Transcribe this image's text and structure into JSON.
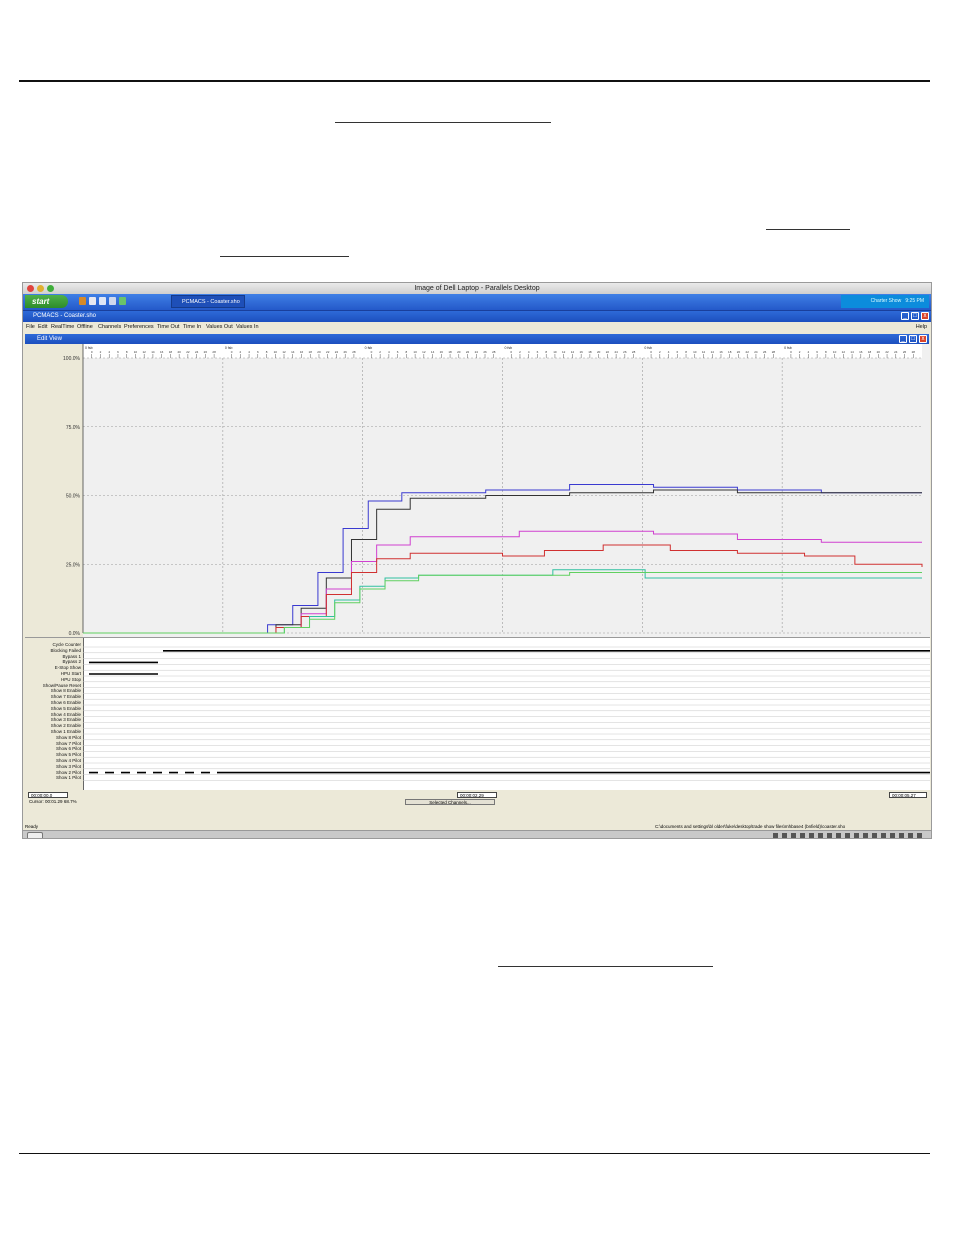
{
  "mac_window": {
    "title": "Image of Dell Laptop - Parallels Desktop"
  },
  "taskbar": {
    "start_label": "start",
    "task_button": "PCMACS - Coaster.sho",
    "tray_text": "Charter Show",
    "clock": "9:25 PM"
  },
  "app": {
    "title": "PCMACS - Coaster.sho",
    "menu": [
      "File",
      "Edit",
      "RealTime",
      "Offline",
      "Channels",
      "Preferences",
      "Time Out",
      "Time In",
      "Values Out",
      "Values In"
    ],
    "help": "Help",
    "edit_view_title": "Edit View"
  },
  "chart_data": {
    "type": "line",
    "y_ticks": [
      "100.0%",
      "75.0%",
      "50.0%",
      "25.0%",
      "0.0%"
    ],
    "ylim": [
      0,
      100
    ],
    "x_frame_labels": [
      "0 fsb",
      "0 fsb",
      "0 fsb",
      "0 fsb",
      "0 fsb",
      "0 fsb"
    ],
    "x_frame_ticks": [
      "0",
      "2",
      "4",
      "6",
      "8",
      "10",
      "12",
      "14",
      "16",
      "18",
      "20",
      "22",
      "24",
      "26",
      "28"
    ],
    "grid": true,
    "series": [
      {
        "color": "#3a3ad0",
        "values": [
          [
            0,
            0
          ],
          [
            18,
            0
          ],
          [
            22,
            3
          ],
          [
            25,
            10
          ],
          [
            28,
            22
          ],
          [
            31,
            38
          ],
          [
            34,
            48
          ],
          [
            38,
            51
          ],
          [
            48,
            52
          ],
          [
            58,
            54
          ],
          [
            68,
            53
          ],
          [
            78,
            52
          ],
          [
            88,
            51
          ],
          [
            100,
            51
          ]
        ]
      },
      {
        "color": "#333333",
        "values": [
          [
            0,
            0
          ],
          [
            19,
            0
          ],
          [
            23,
            3
          ],
          [
            26,
            9
          ],
          [
            29,
            20
          ],
          [
            32,
            34
          ],
          [
            35,
            45
          ],
          [
            39,
            49
          ],
          [
            48,
            50
          ],
          [
            58,
            51
          ],
          [
            68,
            52
          ],
          [
            78,
            51
          ],
          [
            88,
            51
          ],
          [
            100,
            51
          ]
        ]
      },
      {
        "color": "#d040d0",
        "values": [
          [
            0,
            0
          ],
          [
            20,
            0
          ],
          [
            23,
            2
          ],
          [
            26,
            7
          ],
          [
            29,
            16
          ],
          [
            32,
            26
          ],
          [
            35,
            32
          ],
          [
            39,
            35
          ],
          [
            48,
            35
          ],
          [
            52,
            37
          ],
          [
            60,
            37
          ],
          [
            68,
            36
          ],
          [
            78,
            34
          ],
          [
            88,
            33
          ],
          [
            100,
            33
          ]
        ]
      },
      {
        "color": "#d03030",
        "values": [
          [
            0,
            0
          ],
          [
            20,
            0
          ],
          [
            23,
            2
          ],
          [
            26,
            6
          ],
          [
            29,
            14
          ],
          [
            32,
            22
          ],
          [
            35,
            27
          ],
          [
            39,
            29
          ],
          [
            45,
            29
          ],
          [
            50,
            28
          ],
          [
            55,
            30
          ],
          [
            62,
            32
          ],
          [
            70,
            30
          ],
          [
            78,
            29
          ],
          [
            86,
            28
          ],
          [
            92,
            25
          ],
          [
            100,
            24
          ]
        ]
      },
      {
        "color": "#30c0a0",
        "values": [
          [
            0,
            0
          ],
          [
            21,
            0
          ],
          [
            24,
            2
          ],
          [
            27,
            6
          ],
          [
            30,
            12
          ],
          [
            33,
            17
          ],
          [
            36,
            20
          ],
          [
            40,
            21
          ],
          [
            50,
            21
          ],
          [
            56,
            23
          ],
          [
            62,
            23
          ],
          [
            67,
            20
          ],
          [
            75,
            20
          ],
          [
            85,
            20
          ],
          [
            100,
            20
          ]
        ]
      },
      {
        "color": "#60d060",
        "values": [
          [
            0,
            0
          ],
          [
            21,
            0
          ],
          [
            24,
            2
          ],
          [
            27,
            5
          ],
          [
            30,
            11
          ],
          [
            33,
            16
          ],
          [
            36,
            19
          ],
          [
            40,
            21
          ],
          [
            52,
            21
          ],
          [
            58,
            22
          ],
          [
            64,
            22
          ],
          [
            70,
            22
          ],
          [
            80,
            22
          ],
          [
            90,
            22
          ],
          [
            100,
            22
          ]
        ]
      }
    ]
  },
  "channels": [
    "Cycle Counter",
    "Blocking Failed",
    "Bypass 1",
    "Bypass 2",
    "E-Stop Show",
    "HPU Start",
    "HPU Stop",
    "Show/Pause Reset",
    "Show 8 Enable",
    "Show 7 Enable",
    "Show 6 Enable",
    "Show 5 Enable",
    "Show 4 Enable",
    "Show 3 Enable",
    "Show 2 Enable",
    "Show 1 Enable",
    "Show 8 Pilot",
    "Show 7 Pilot",
    "Show 6 Pilot",
    "Show 5 Pilot",
    "Show 4 Pilot",
    "Show 3 Pilot",
    "Show 2 Pilot",
    "Show 1 Pilot"
  ],
  "bottom": {
    "timecode_start": "00:00:00.0",
    "timecode_mid": "00:00:02.29",
    "timecode_end": "00:00:05.27",
    "cursor_label": "Cursor",
    "cursor_time": "00:01.29",
    "cursor_value": "68.7%",
    "selected_channels_button": "Selected Channels..."
  },
  "status": {
    "ready": "Ready",
    "path": "C:\\documents and settings\\bl older\\fuke\\desktop\\trade show files\\mhbase4 (bnfield)\\coaster.sho"
  }
}
